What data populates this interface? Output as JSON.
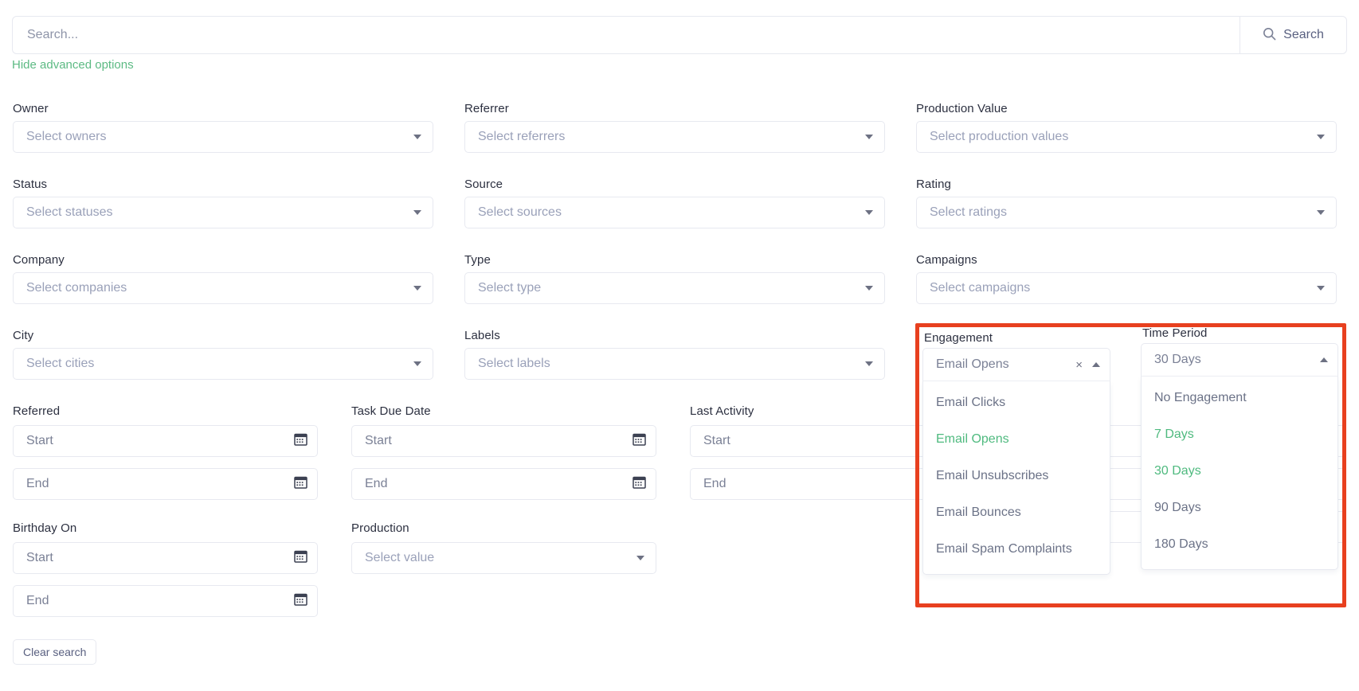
{
  "search": {
    "placeholder": "Search...",
    "value": "",
    "button_label": "Search",
    "icon": "search-icon"
  },
  "advanced_toggle": {
    "label": "Hide advanced options",
    "color": "#5cba83"
  },
  "colors": {
    "accent_green": "#5cba83",
    "highlight_red": "#e8401f",
    "label_text": "#2c3040",
    "placeholder_text": "#9aa1b9",
    "border": "#e7e9f0"
  },
  "selects": [
    {
      "label": "Owner",
      "placeholder": "Select owners"
    },
    {
      "label": "Referrer",
      "placeholder": "Select referrers"
    },
    {
      "label": "Production Value",
      "placeholder": "Select production values"
    },
    {
      "label": "Status",
      "placeholder": "Select statuses"
    },
    {
      "label": "Source",
      "placeholder": "Select sources"
    },
    {
      "label": "Rating",
      "placeholder": "Select ratings"
    },
    {
      "label": "Company",
      "placeholder": "Select companies"
    },
    {
      "label": "Type",
      "placeholder": "Select type"
    },
    {
      "label": "Campaigns",
      "placeholder": "Select campaigns"
    },
    {
      "label": "City",
      "placeholder": "Select cities"
    },
    {
      "label": "Labels",
      "placeholder": "Select labels"
    }
  ],
  "date_ranges": [
    {
      "label": "Referred",
      "start_placeholder": "Start",
      "end_placeholder": "End"
    },
    {
      "label": "Task Due Date",
      "start_placeholder": "Start",
      "end_placeholder": "End"
    },
    {
      "label": "Last Activity",
      "start_placeholder": "Start",
      "end_placeholder": "End"
    },
    {
      "label": "Birthday On",
      "start_placeholder": "Start",
      "end_placeholder": "End"
    }
  ],
  "production_select": {
    "label": "Production",
    "placeholder": "Select value"
  },
  "engagement": {
    "label": "Engagement",
    "selected": "Email Opens",
    "clear_glyph": "×",
    "expanded": true,
    "options": [
      {
        "label": "Email Clicks",
        "selected": false
      },
      {
        "label": "Email Opens",
        "selected": true
      },
      {
        "label": "Email Unsubscribes",
        "selected": false
      },
      {
        "label": "Email Bounces",
        "selected": false
      },
      {
        "label": "Email Spam Complaints",
        "selected": false
      }
    ]
  },
  "time_period": {
    "label": "Time Period",
    "selected": "30 Days",
    "expanded": true,
    "options": [
      {
        "label": "No Engagement",
        "selected": false
      },
      {
        "label": "7 Days",
        "selected": true
      },
      {
        "label": "30 Days",
        "selected": true
      },
      {
        "label": "90 Days",
        "selected": false
      },
      {
        "label": "180 Days",
        "selected": false
      }
    ]
  },
  "clear_search": {
    "label": "Clear search"
  }
}
